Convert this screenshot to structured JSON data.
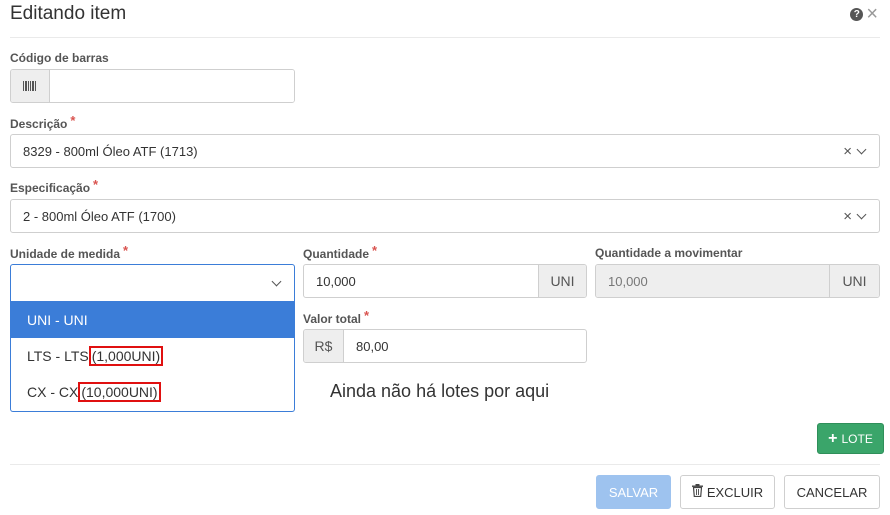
{
  "modal": {
    "title": "Editando item"
  },
  "barcode": {
    "label": "Código de barras",
    "value": ""
  },
  "description": {
    "label": "Descrição",
    "required_mark": "*",
    "value": "8329 - 800ml Óleo ATF (1713)",
    "clear": "×"
  },
  "specification": {
    "label": "Especificação",
    "required_mark": "*",
    "value": "2 - 800ml Óleo ATF (1700)",
    "clear": "×"
  },
  "unit": {
    "label": "Unidade de medida",
    "required_mark": "*",
    "value": "",
    "options": [
      {
        "text": "UNI - UNI",
        "extra": ""
      },
      {
        "text": "LTS - LTS",
        "extra": "(1,000UNI)"
      },
      {
        "text": "CX - CX",
        "extra": "(10,000UNI)"
      }
    ]
  },
  "quantity": {
    "label": "Quantidade",
    "required_mark": "*",
    "value": "10,000",
    "unit": "UNI"
  },
  "quantity_move": {
    "label": "Quantidade a movimentar",
    "value": "10,000",
    "unit": "UNI"
  },
  "total": {
    "label": "Valor total",
    "required_mark": "*",
    "currency": "R$",
    "value": "80,00"
  },
  "lots": {
    "empty_message": "Ainda não há lotes por aqui",
    "add_label": "LOTE"
  },
  "actions": {
    "save": "SALVAR",
    "delete": "EXCLUIR",
    "cancel": "CANCELAR"
  },
  "colors": {
    "primary": "#3b7dd8",
    "success": "#3aa56a",
    "danger_highlight": "#e01010"
  }
}
